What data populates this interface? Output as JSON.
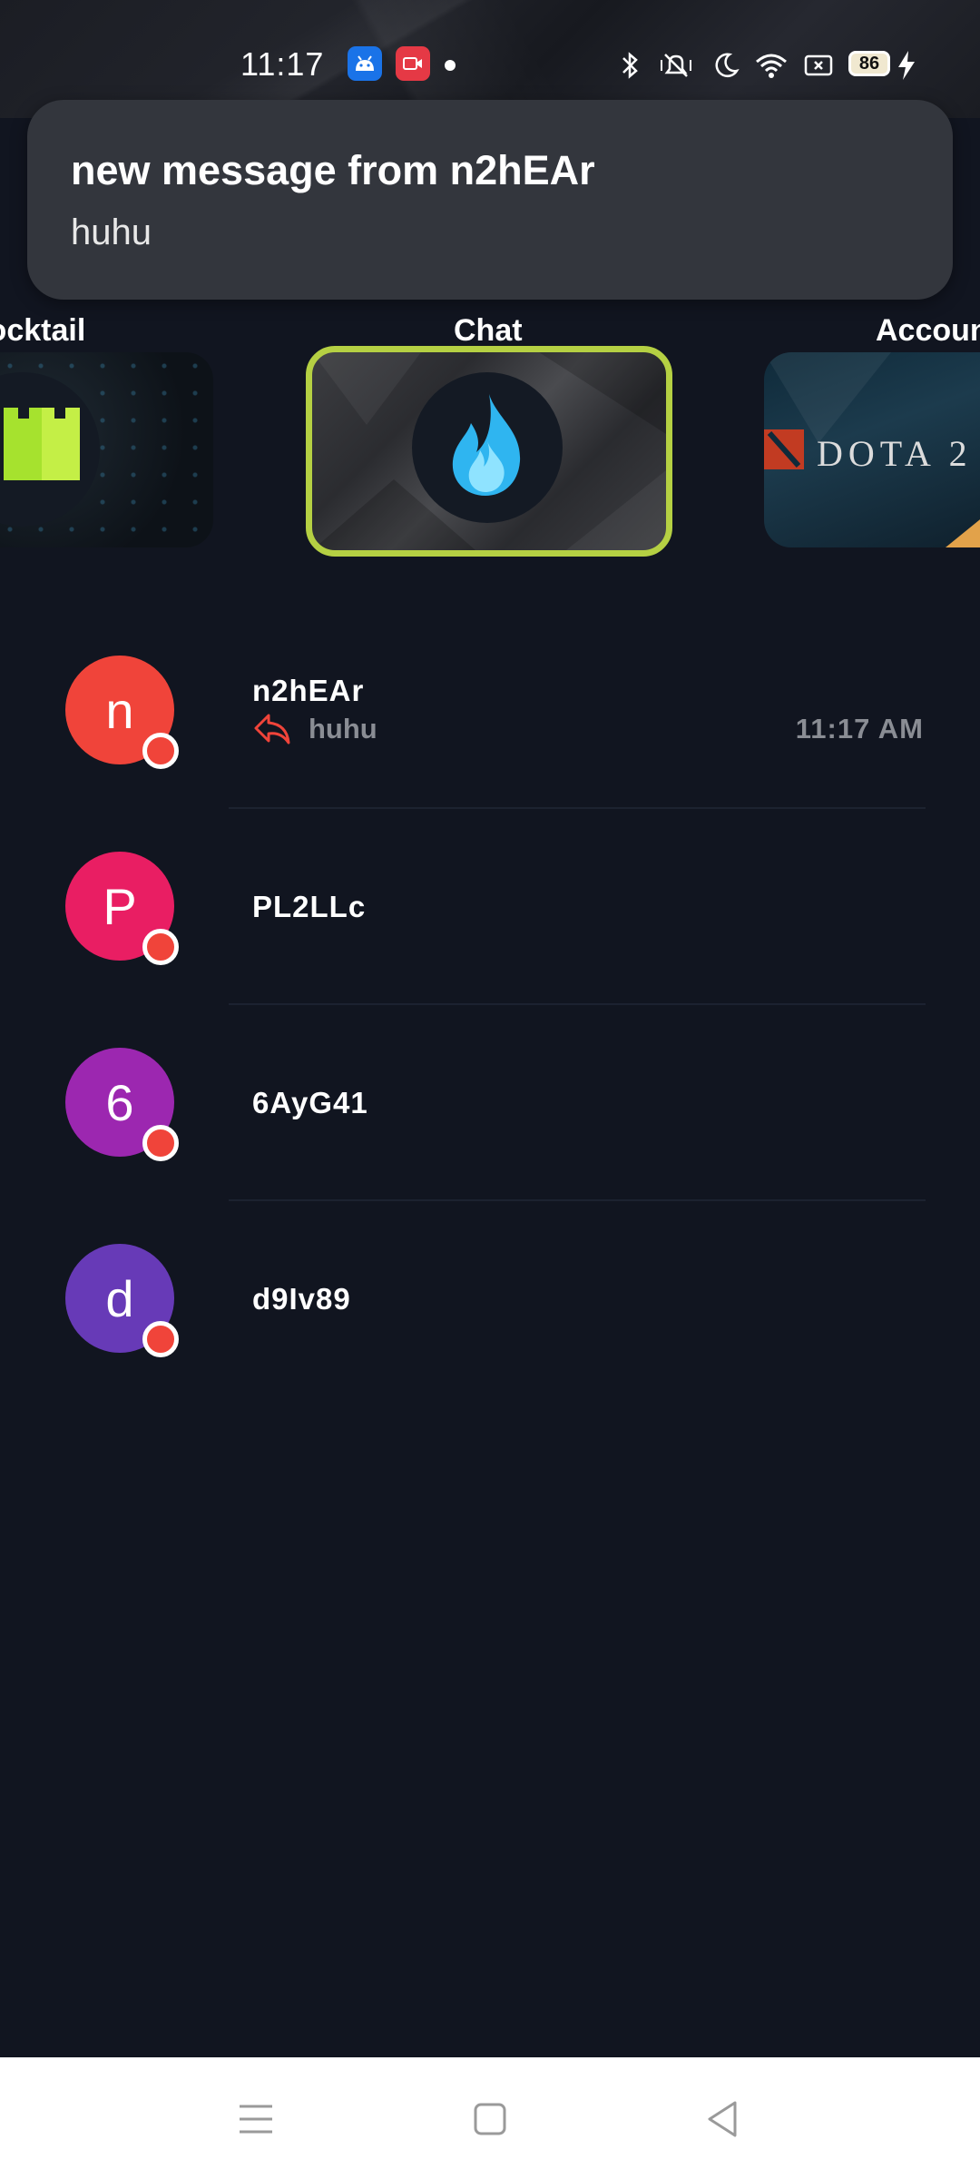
{
  "status_bar": {
    "time": "11:17",
    "battery": "86",
    "icons": [
      "android-debug-icon",
      "screen-record-icon",
      "notification-dot-icon",
      "bluetooth-icon",
      "silent-icon",
      "do-not-disturb-icon",
      "wifi-icon",
      "screen-cast-icon",
      "battery-icon",
      "charging-icon"
    ]
  },
  "notification": {
    "title": "new message from n2hEAr",
    "body": "huhu"
  },
  "carousel": {
    "tabs": [
      {
        "label": "Cocktail",
        "icon": "castle-icon",
        "selected": false
      },
      {
        "label": "Chat",
        "icon": "flame-icon",
        "selected": true
      },
      {
        "label": "Account",
        "icon": "dota2-logo",
        "selected": false
      }
    ],
    "account_card_text": "DOTA 2",
    "accent_color": "#b5d043"
  },
  "chats": [
    {
      "initial": "n",
      "name": "n2hEAr",
      "preview": "huhu",
      "time": "11:17 AM",
      "avatar_color": "#f0443a",
      "unread": true
    },
    {
      "initial": "P",
      "name": "PL2LLc",
      "preview": "",
      "time": "",
      "avatar_color": "#e91e63",
      "unread": true
    },
    {
      "initial": "6",
      "name": "6AyG41",
      "preview": "",
      "time": "",
      "avatar_color": "#9c27b0",
      "unread": true
    },
    {
      "initial": "d",
      "name": "d9Iv89",
      "preview": "",
      "time": "",
      "avatar_color": "#673ab7",
      "unread": true
    }
  ],
  "nav_bar": {
    "buttons": [
      "menu-icon",
      "home-icon",
      "back-icon"
    ]
  }
}
